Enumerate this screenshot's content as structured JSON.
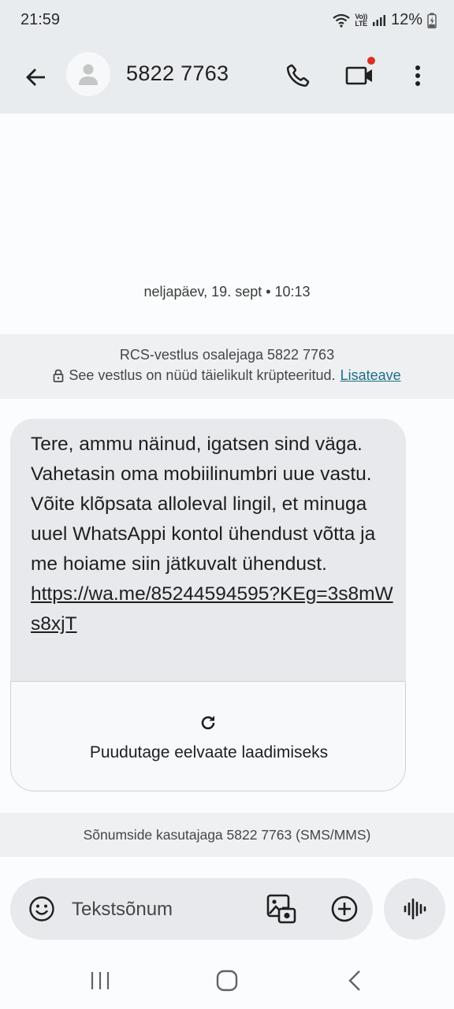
{
  "status_bar": {
    "time": "21:59",
    "volte_label_top": "Vo))",
    "volte_label_bottom": "LTE",
    "battery": "12%",
    "icons": [
      "wifi-icon",
      "volte-icon",
      "signal-icon",
      "battery-charging-icon"
    ]
  },
  "header": {
    "contact": "5822 7763",
    "icons": [
      "back-arrow-icon",
      "person-icon",
      "phone-icon",
      "video-camera-icon",
      "more-vert-icon"
    ],
    "video_badge_color": "#d93025"
  },
  "conversation": {
    "date": "neljapäev, 19. sept • 10:13",
    "rcs_banner": {
      "line1": "RCS-vestlus osalejaga 5822 7763",
      "line2": "See vestlus on nüüd täielikult krüpteeritud.",
      "learn_more": "Lisateave",
      "icon": "lock-icon"
    },
    "message": {
      "text": "Tere, ammu näinud, igatsen sind väga. Vahetasin oma mobiilinumbri uue vastu. Võite klõpsata alloleval lingil, et minuga uuel WhatsAppi kontol ühendust võtta ja me hoiame siin jätkuvalt ühendust.",
      "link": "https://wa.me/85244594595?KEg=3s8mWs8xjT",
      "preview_label": "Puudutage eelvaate laadimiseks",
      "preview_icon": "refresh-icon"
    },
    "sms_banner": "Sõnumside kasutajaga 5822 7763 (SMS/MMS)"
  },
  "composer": {
    "placeholder": "Tekstsõnum",
    "icons": [
      "emoji-icon",
      "gallery-icon",
      "add-circle-icon",
      "voice-waveform-icon"
    ]
  },
  "nav_bar": {
    "icons": [
      "recents-icon",
      "home-icon",
      "back-icon"
    ]
  },
  "colors": {
    "app_bar": "#e9ecef",
    "background": "#fbfcfd",
    "bubble": "#e7e9ec",
    "link": "#1b6e8a"
  }
}
